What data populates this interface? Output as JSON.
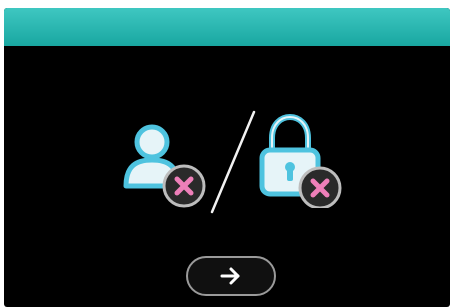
{
  "screen": {
    "header_color_start": "#3fc7c1",
    "header_color_end": "#1aa9a3",
    "background_color": "#000000"
  },
  "icons": {
    "user": "user-icon",
    "divider": "slash-divider",
    "lock": "lock-icon",
    "error_badge": "error-x-icon"
  },
  "colors": {
    "icon_fill": "#e6f4f8",
    "icon_outline": "#4ec3df",
    "badge_fill": "#2a2a2a",
    "badge_border": "#bdbdbd",
    "badge_x": "#ee7fb9"
  },
  "actions": {
    "next": "arrow-right-icon"
  }
}
